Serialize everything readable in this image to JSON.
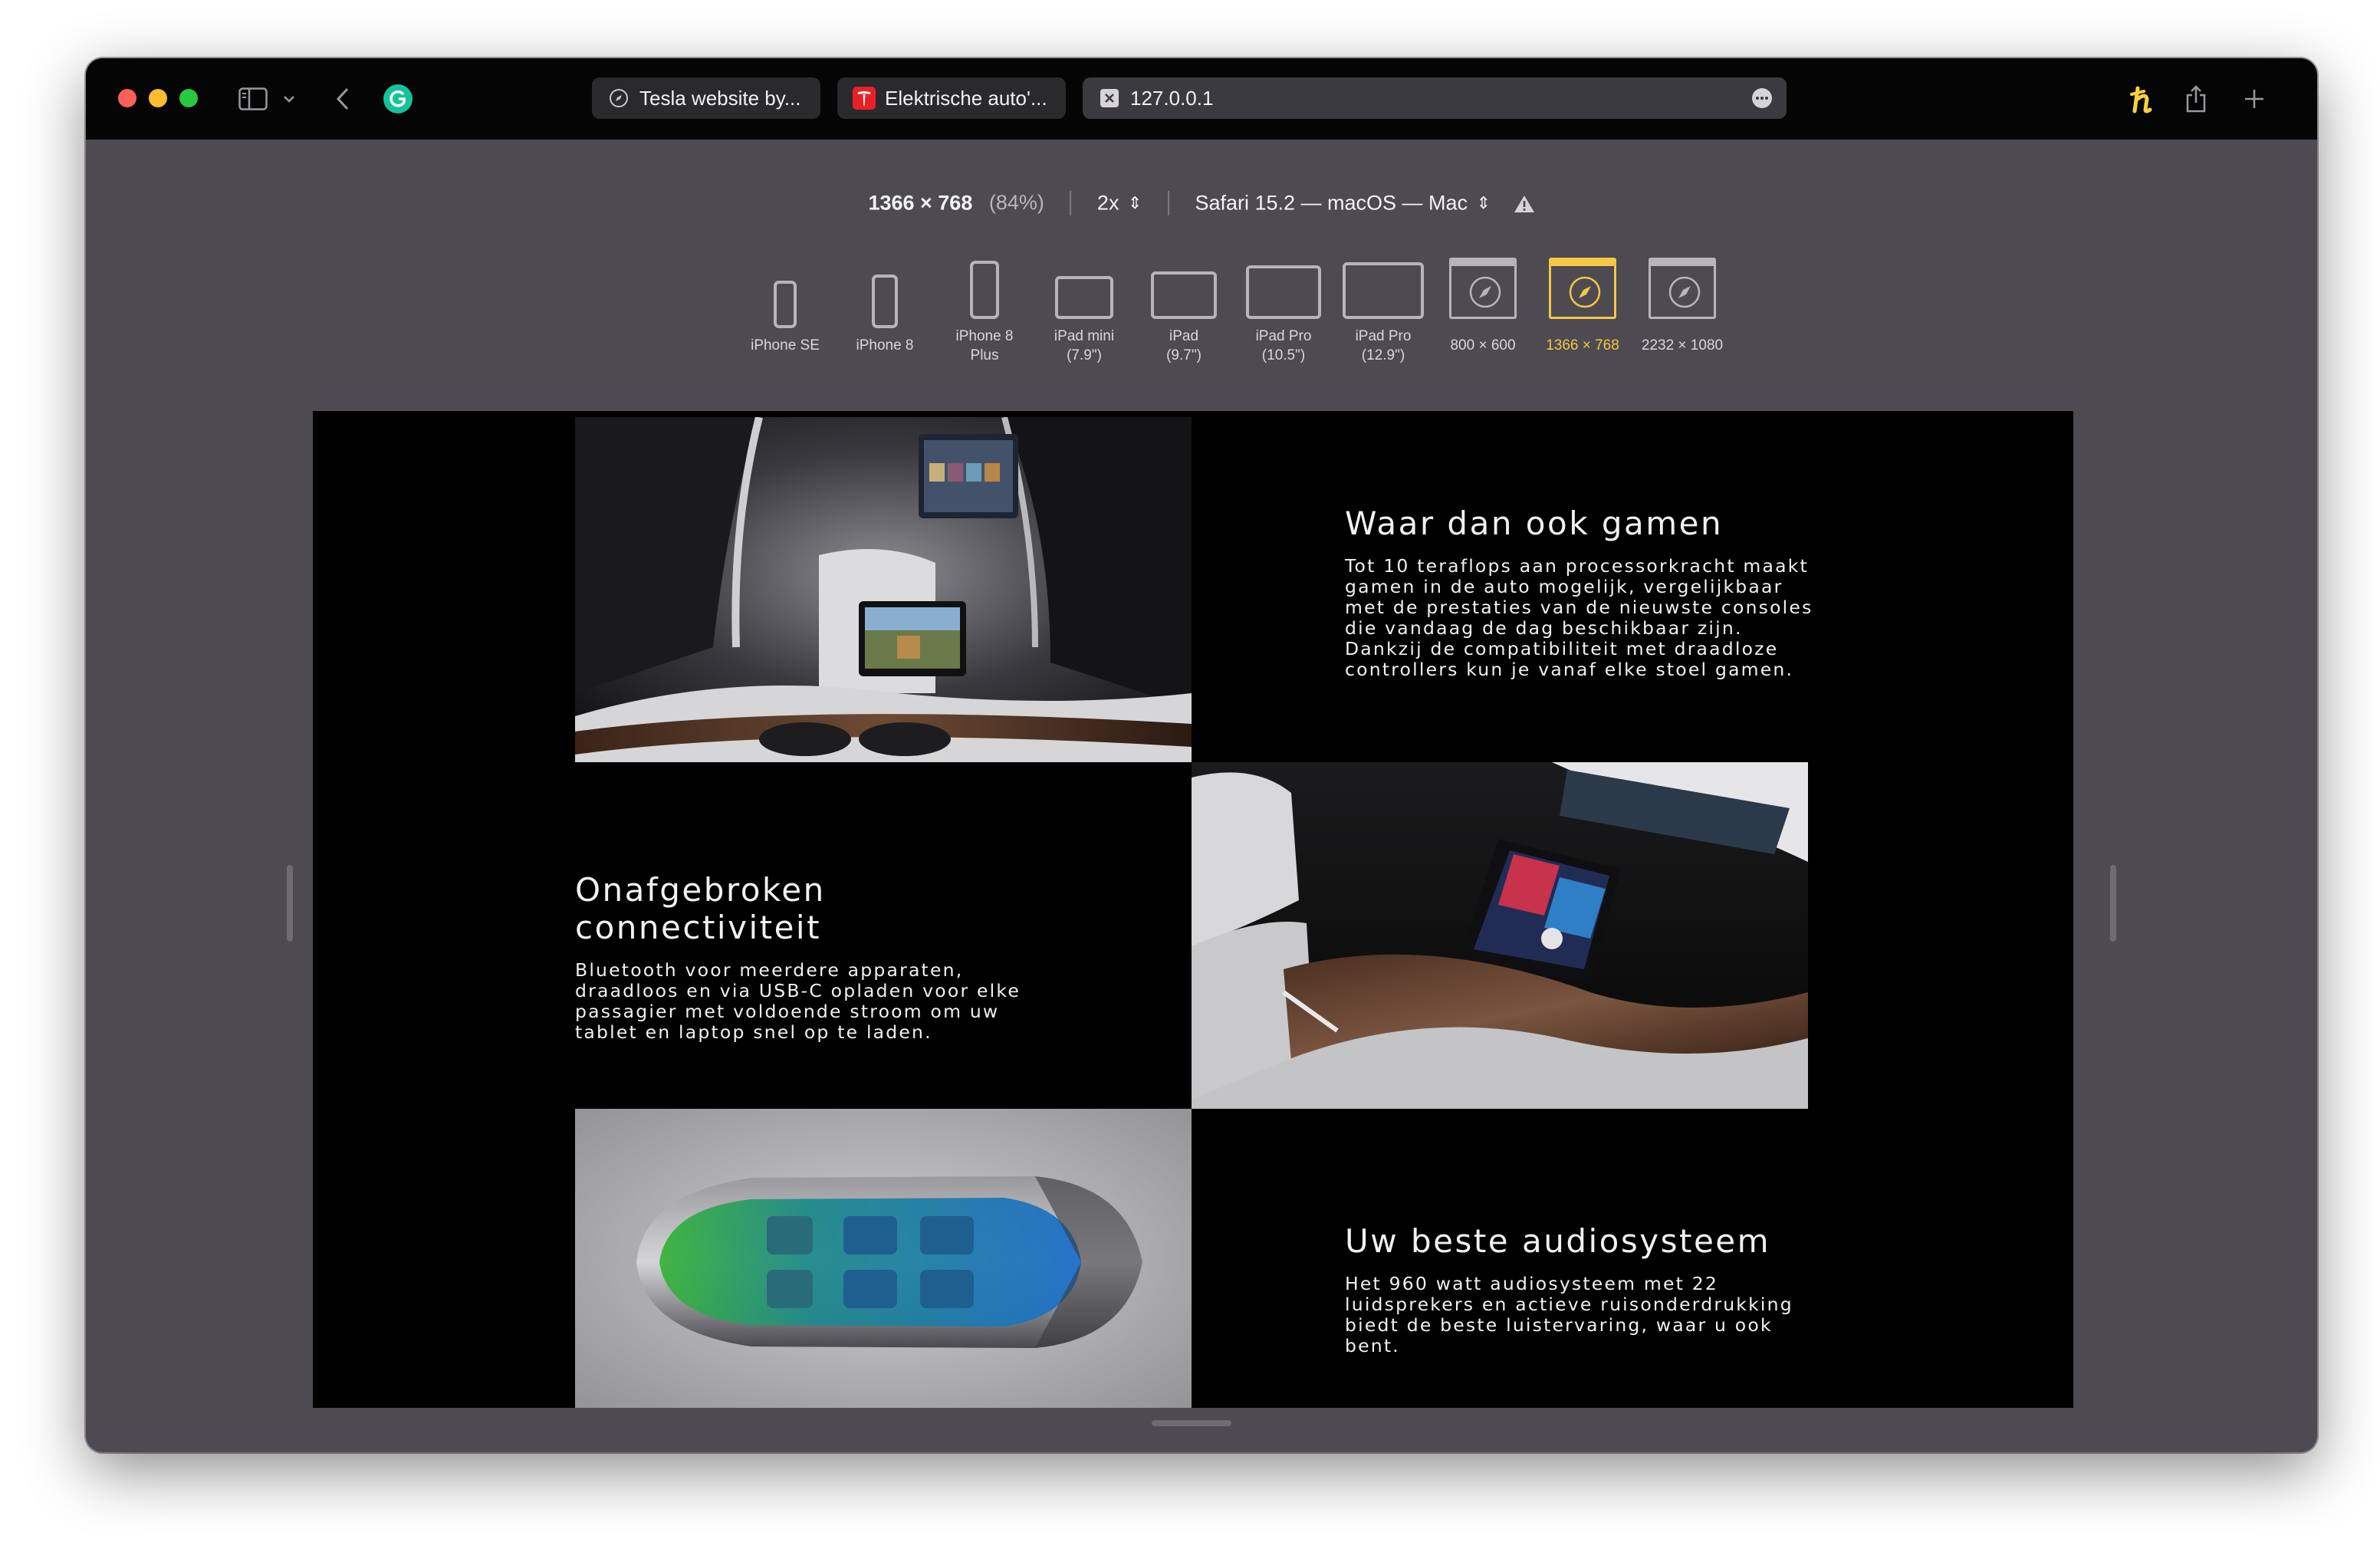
{
  "browser": {
    "tabs": [
      {
        "title": "Tesla website by...",
        "icon": "compass-icon"
      },
      {
        "title": "Elektrische auto'...",
        "icon": "tesla-logo-icon"
      },
      {
        "title": "127.0.0.1",
        "icon": "close-icon"
      }
    ]
  },
  "responsive": {
    "dimensions": "1366 × 768",
    "zoom": "(84%)",
    "scale": "2x",
    "user_agent": "Safari 15.2 — macOS — Mac",
    "devices": [
      {
        "label_1": "iPhone SE",
        "label_2": ""
      },
      {
        "label_1": "iPhone 8",
        "label_2": ""
      },
      {
        "label_1": "iPhone 8",
        "label_2": "Plus"
      },
      {
        "label_1": "iPad mini",
        "label_2": "(7.9\")"
      },
      {
        "label_1": "iPad",
        "label_2": "(9.7\")"
      },
      {
        "label_1": "iPad Pro",
        "label_2": "(10.5\")"
      },
      {
        "label_1": "iPad Pro",
        "label_2": "(12.9\")"
      },
      {
        "label_1": "800 × 600",
        "label_2": ""
      },
      {
        "label_1": "1366 × 768",
        "label_2": ""
      },
      {
        "label_1": "2232 × 1080",
        "label_2": ""
      }
    ],
    "selected_color": "#f6c644"
  },
  "page": {
    "sections": [
      {
        "title": "Waar dan ook gamen",
        "body": "Tot 10 teraflops aan processorkracht maakt gamen in de auto mogelijk, vergelijkbaar met de prestaties van de nieuwste consoles die vandaag de dag beschikbaar zijn. Dankzij de compatibiliteit met draadloze controllers kun je vanaf elke stoel gamen."
      },
      {
        "title": "Onafgebroken connectiviteit",
        "body": "Bluetooth voor meerdere apparaten, draadloos en via USB-C opladen voor elke passagier met voldoende stroom om uw tablet en laptop snel op te laden."
      },
      {
        "title": "Uw beste audiosysteem",
        "body": "Het 960 watt audiosysteem met 22 luidsprekers en actieve ruisonderdrukking biedt de beste luistervaring, waar u ook bent."
      }
    ]
  }
}
